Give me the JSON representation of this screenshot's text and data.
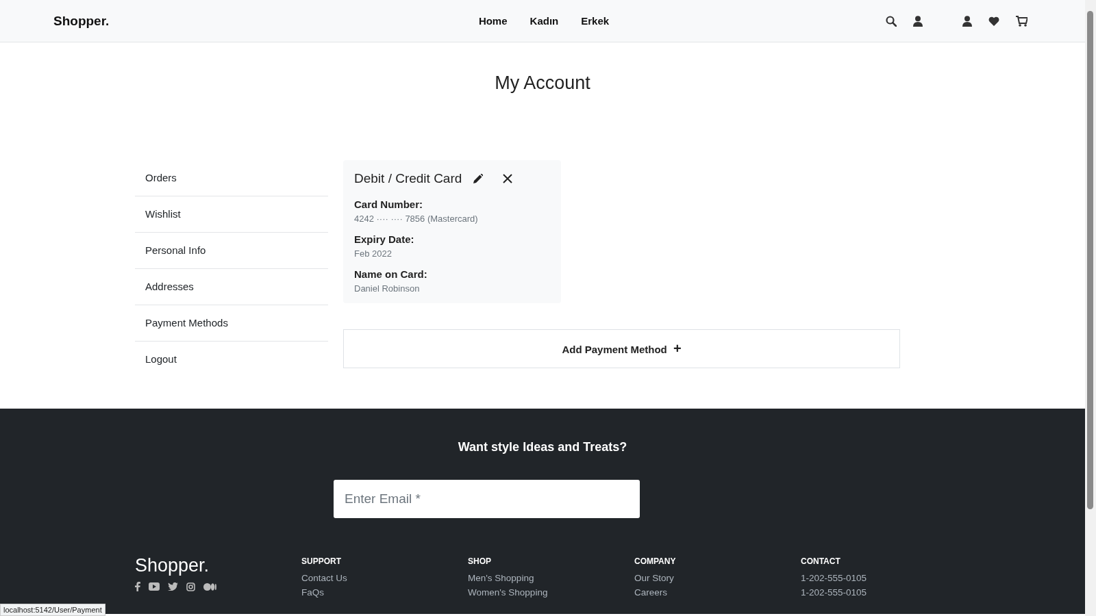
{
  "header": {
    "logo": "Shopper.",
    "nav": [
      {
        "label": "Home"
      },
      {
        "label": "Kadın"
      },
      {
        "label": "Erkek"
      }
    ]
  },
  "page_title": "My Account",
  "sidebar": {
    "items": [
      {
        "label": "Orders"
      },
      {
        "label": "Wishlist"
      },
      {
        "label": "Personal Info"
      },
      {
        "label": "Addresses"
      },
      {
        "label": "Payment Methods"
      },
      {
        "label": "Logout"
      }
    ]
  },
  "payment_card": {
    "title": "Debit / Credit Card",
    "fields": [
      {
        "label": "Card Number:",
        "value": "4242 ···· ···· 7856 (Mastercard)"
      },
      {
        "label": "Expiry Date:",
        "value": "Feb 2022"
      },
      {
        "label": "Name on Card:",
        "value": "Daniel Robinson"
      }
    ]
  },
  "add_button": {
    "label": "Add Payment Method",
    "icon": "+"
  },
  "footer": {
    "heading": "Want style Ideas and Treats?",
    "email": {
      "placeholder": "Enter Email *"
    },
    "logo": "Shopper.",
    "columns": [
      {
        "title": "SUPPORT",
        "links": [
          "Contact Us",
          "FaQs"
        ]
      },
      {
        "title": "SHOP",
        "links": [
          "Men's Shopping",
          "Women's Shopping"
        ]
      },
      {
        "title": "COMPANY",
        "links": [
          "Our Story",
          "Careers"
        ]
      },
      {
        "title": "CONTACT",
        "links": [
          "1-202-555-0105",
          "1-202-555-0105"
        ]
      }
    ]
  },
  "status_url": "localhost:5142/User/Payment"
}
